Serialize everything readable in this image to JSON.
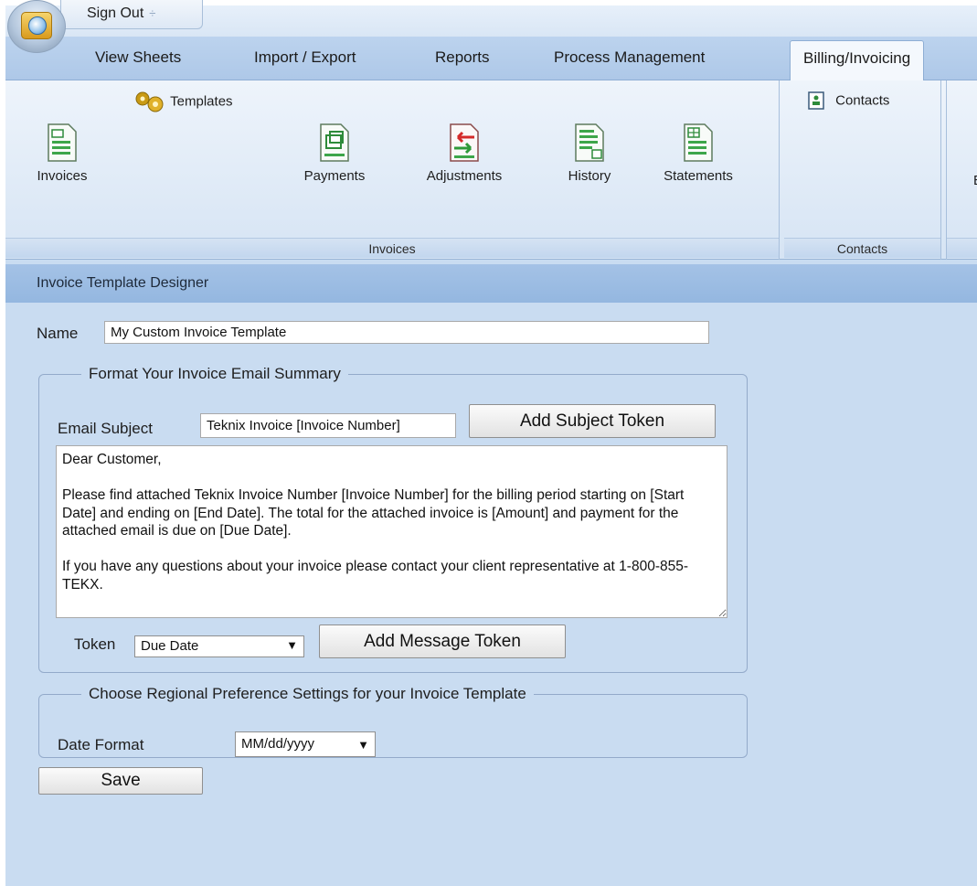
{
  "titlebar": {
    "signout_label": "Sign Out",
    "signout_caret": "÷"
  },
  "ribbon_tabs": [
    {
      "label": "View Sheets",
      "active": false
    },
    {
      "label": "Import / Export",
      "active": false
    },
    {
      "label": "Reports",
      "active": false
    },
    {
      "label": "Process Management",
      "active": false
    },
    {
      "label": "Billing/Invoicing",
      "active": true
    }
  ],
  "ribbon": {
    "invoices_group": {
      "label": "Invoices",
      "templates_label": "Templates",
      "buttons": [
        {
          "label": "Invoices",
          "icon": "invoice-doc-icon"
        },
        {
          "label": "Payments",
          "icon": "payments-doc-icon"
        },
        {
          "label": "Adjustments",
          "icon": "adjustments-doc-icon"
        },
        {
          "label": "History",
          "icon": "history-doc-icon"
        },
        {
          "label": "Statements",
          "icon": "statements-doc-icon"
        }
      ]
    },
    "contacts_group": {
      "label": "Contacts",
      "contacts_label": "Contacts"
    },
    "partial_group": {
      "label_fragment": "E"
    }
  },
  "designer": {
    "title": "Invoice Template Designer",
    "name_label": "Name",
    "name_value": "My Custom Invoice Template",
    "email_section": {
      "legend": "Format Your Invoice Email Summary",
      "subject_label": "Email Subject",
      "subject_value": "Teknix Invoice [Invoice Number]",
      "add_subject_token_label": "Add Subject Token",
      "message_value": "Dear Customer,\n\nPlease find attached Teknix Invoice Number [Invoice Number] for the billing period starting on [Start Date] and ending on [End Date]. The total for the attached invoice is [Amount] and payment for the attached email is due on [Due Date].\n\nIf you have any questions about your invoice please contact your client representative at 1-800-855-TEKX.",
      "token_label": "Token",
      "token_selected": "Due Date",
      "add_message_token_label": "Add Message Token"
    },
    "regional_section": {
      "legend": "Choose Regional Preference Settings for your Invoice Template",
      "date_format_label": "Date Format",
      "date_format_selected": "MM/dd/yyyy"
    },
    "save_label": "Save"
  },
  "colors": {
    "app_background": "#c9dcf1",
    "designer_bar": "#a4c2e6",
    "ribbon_tab_bar": "#bcd3ee"
  }
}
